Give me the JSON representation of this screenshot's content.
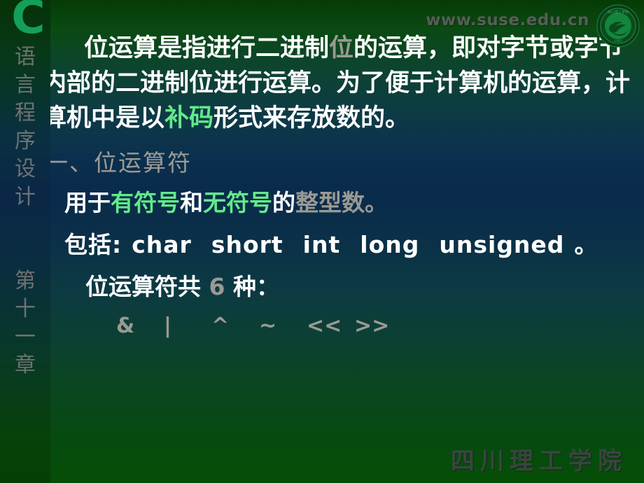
{
  "header": {
    "site_url": "www.suse.edu.cn",
    "logo_name": "suse-university-seal"
  },
  "sidebar": {
    "letter": "C",
    "block1": [
      "语",
      "言",
      "程",
      "序",
      "设",
      "计"
    ],
    "block2": [
      "第",
      "十",
      "一",
      "章"
    ]
  },
  "body": {
    "paragraph": {
      "seg1": "位运算是指进行二进制",
      "seg2_highlight_gray": "位",
      "seg3": "的运算，即对字节或字节内部的二进制位进行运算。为了便于计算机的运算，计算机中是以",
      "seg4_highlight_green": "补码",
      "seg5": "形式来存放数的。"
    },
    "heading": "一、位运算符",
    "usage": {
      "seg1": "用于",
      "seg2_green": "有符号",
      "seg3": "和",
      "seg4_green": "无符号",
      "seg5": "的",
      "seg6_gray": "整型数",
      "seg7_gray": "。"
    },
    "types": {
      "label": "包括:",
      "keywords": [
        "char",
        "short",
        "int",
        "long",
        "unsigned"
      ],
      "trailing": "。"
    },
    "count": {
      "seg1": "位运算符共",
      "number": "6",
      "seg2": "种："
    },
    "operators": [
      "&",
      "|",
      "^",
      "~",
      "<<",
      ">>"
    ]
  },
  "footer": {
    "institution": "四川理工学院"
  },
  "colors": {
    "accent_green": "#63e98a",
    "muted_gray": "#9a9a92",
    "logo_green": "#14a05a",
    "text_white": "#ffffff"
  }
}
